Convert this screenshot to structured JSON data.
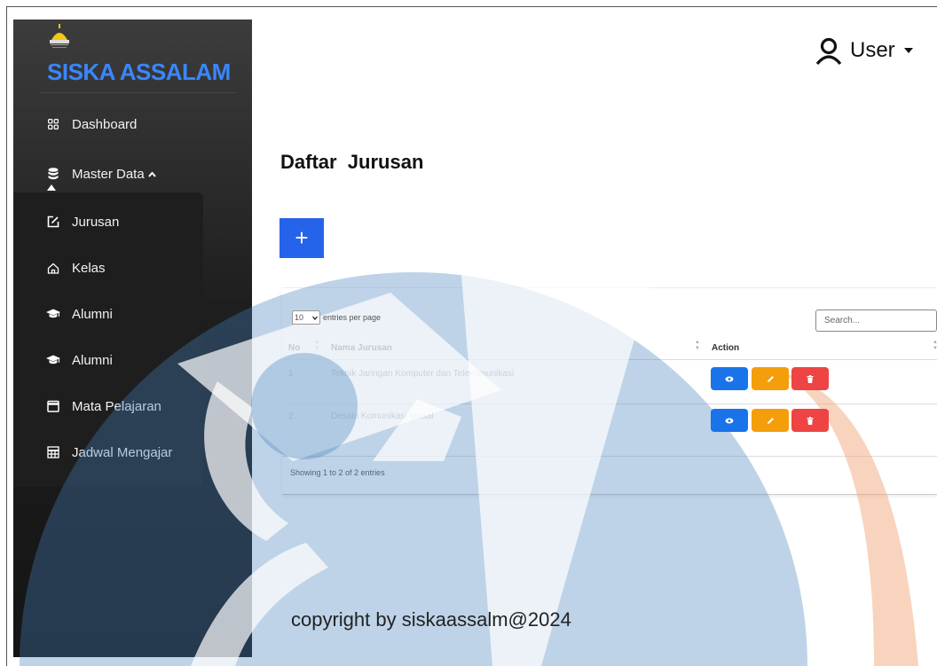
{
  "sidebar": {
    "brand": "SISKA ASSALAM",
    "items": [
      {
        "label": "Dashboard",
        "icon": "dashboard-grid-icon"
      },
      {
        "label": "Master Data",
        "icon": "database-icon"
      },
      {
        "label": "Jurusan",
        "icon": "edit-square-icon"
      },
      {
        "label": "Kelas",
        "icon": "home-icon"
      },
      {
        "label": "Alumni",
        "icon": "graduation-cap-icon"
      },
      {
        "label": "Alumni",
        "icon": "graduation-cap-icon"
      },
      {
        "label": "Mata Pelajaran",
        "icon": "calendar-icon"
      },
      {
        "label": "Jadwal Mengajar",
        "icon": "table-icon"
      }
    ]
  },
  "header": {
    "user_label": "User"
  },
  "page": {
    "title": "Daftar  Jurusan",
    "add_label": "+"
  },
  "table": {
    "entries_value": "10",
    "entries_label": "entries per page",
    "search_placeholder": "Search...",
    "columns": [
      "No",
      "Nama Jurusan",
      "Action"
    ],
    "rows": [
      {
        "no": "1",
        "nama": "Teknik Jaringan Komputer dan Telekomunikasi"
      },
      {
        "no": "2",
        "nama": "Desain Komunikasi Visual"
      }
    ],
    "info": "Showing 1 to 2 of 2 entries"
  },
  "footer": {
    "text": "copyright by siskaassalm@2024"
  },
  "colors": {
    "accent": "#2563eb",
    "view": "#1a73e8",
    "edit": "#f59e0b",
    "delete": "#ef4444",
    "brand": "#3a86ff"
  }
}
